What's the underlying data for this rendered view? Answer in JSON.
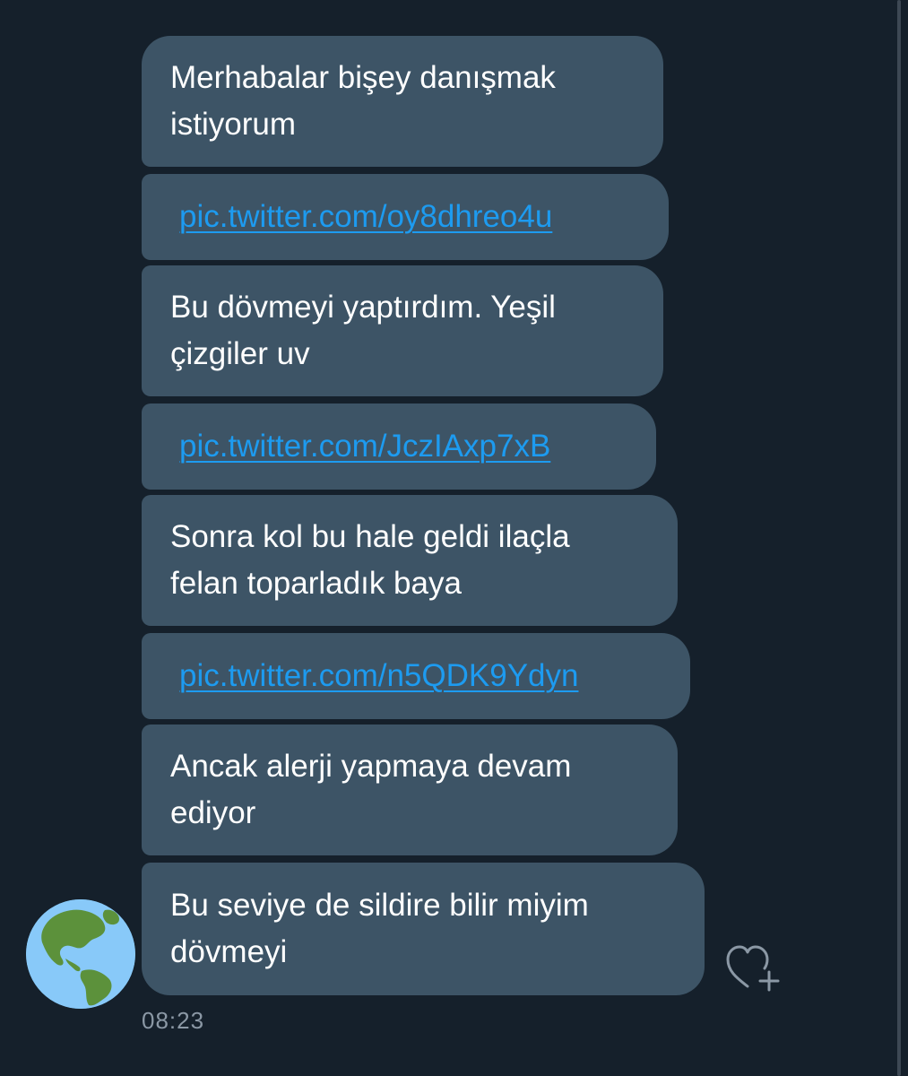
{
  "messages": [
    {
      "text": "Merhabalar bişey danışmak\nistiyorum",
      "type": "text"
    },
    {
      "text": "pic.twitter.com/oy8dhreo4u",
      "type": "link"
    },
    {
      "text": "Bu dövmeyi yaptırdım. Yeşil\nçizgiler uv",
      "type": "text"
    },
    {
      "text": "pic.twitter.com/JczIAxp7xB",
      "type": "link"
    },
    {
      "text": "Sonra kol bu hale geldi ilaçla\nfelan toparladık baya",
      "type": "text"
    },
    {
      "text": "pic.twitter.com/n5QDK9Ydyn",
      "type": "link"
    },
    {
      "text": "Ancak alerji yapmaya devam\nediyor",
      "type": "text"
    },
    {
      "text": "Bu seviye de sildire bilir miyim\ndövmeyi",
      "type": "text"
    }
  ],
  "timestamp": "08:23",
  "avatar_icon": "globe-americas-icon",
  "reaction_icon": "heart-add-icon",
  "colors": {
    "background": "#15202b",
    "bubble": "#3d5466",
    "link": "#1d9bf0",
    "muted": "#8b98a5"
  }
}
